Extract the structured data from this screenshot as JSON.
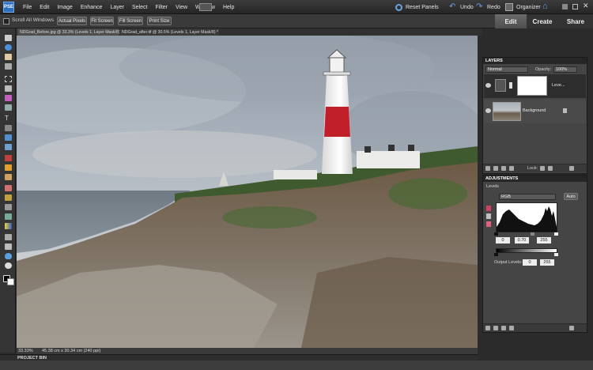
{
  "app": {
    "logo": "PSE"
  },
  "menu": [
    "File",
    "Edit",
    "Image",
    "Enhance",
    "Layer",
    "Select",
    "Filter",
    "View",
    "Window",
    "Help"
  ],
  "top_actions": {
    "reset_panels": "Reset Panels",
    "undo": "Undo",
    "redo": "Redo",
    "organizer": "Organizer"
  },
  "mode_tabs": {
    "edit": "Edit",
    "create": "Create",
    "share": "Share"
  },
  "options_bar": {
    "scroll_all_label": "Scroll All Windows",
    "actual_pixels": "Actual Pixels",
    "fit_screen": "Fit Screen",
    "fill_screen": "Fill Screen",
    "print_size": "Print Size"
  },
  "documents": [
    {
      "title": "NDGrad_Before.jpg @ 33.3% (Levels 1, Layer Mask/8) *"
    },
    {
      "title": "NDGrad_after.tif @ 30.5% (Levels 1, Layer Mask/8) *"
    }
  ],
  "status": {
    "zoom": "33.33%",
    "doc_size": "45.38 cm x 30.34 cm (240 ppi)"
  },
  "project_bin": "PROJECT BIN",
  "layers_panel": {
    "title": "LAYERS",
    "blend_mode": "Normal",
    "opacity_label": "Opacity:",
    "opacity_value": "100%",
    "layers": [
      {
        "name": "Leve..."
      },
      {
        "name": "Background"
      }
    ],
    "lock_label": "Lock:"
  },
  "adjustments_panel": {
    "title": "ADJUSTMENTS",
    "adjustment_name": "Levels",
    "channel": "RGB",
    "auto_label": "Auto",
    "input_black": "0",
    "input_gamma": "0.70",
    "input_white": "255",
    "output_label": "Output Levels:",
    "output_black": "0",
    "output_white": "255"
  },
  "colors": {
    "accent": "#2a6fc0",
    "panel_bg": "#454545",
    "app_bg": "#2b2b2b"
  }
}
